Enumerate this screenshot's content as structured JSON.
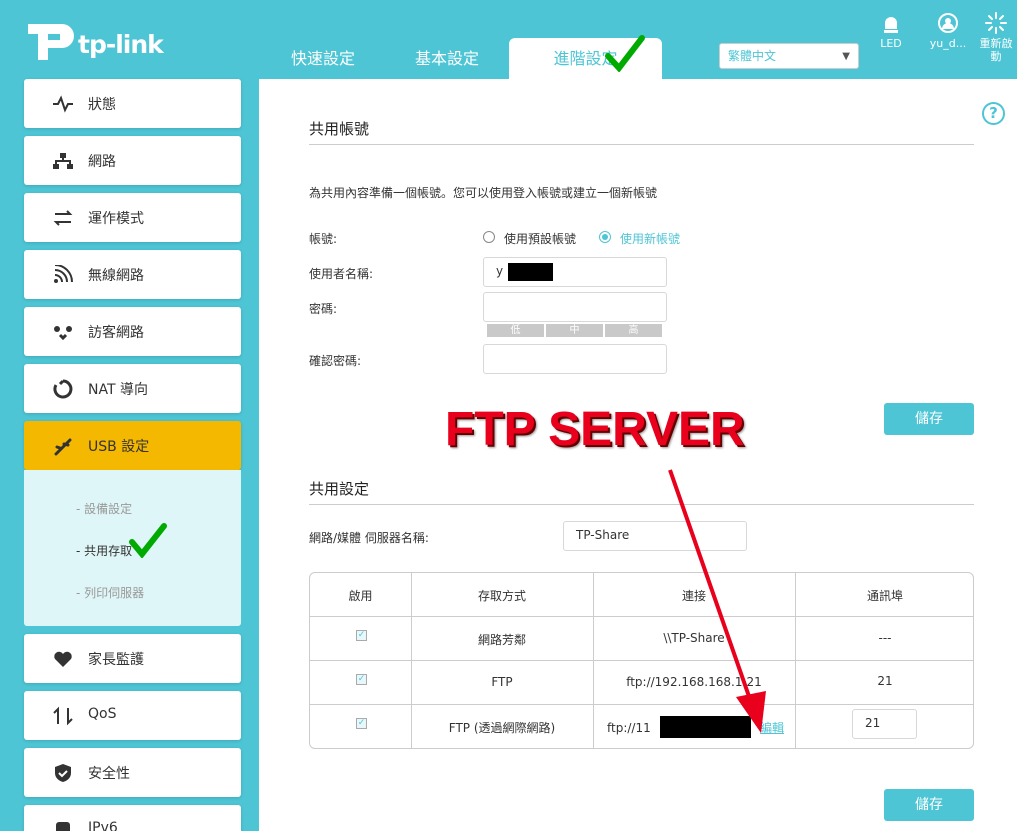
{
  "header": {
    "logo_text": "tp-link",
    "tabs": [
      "快速設定",
      "基本設定",
      "進階設定"
    ],
    "language": "繁體中文",
    "icons": [
      {
        "name": "led-icon",
        "label": "LED"
      },
      {
        "name": "user-icon",
        "label": "yu_d..."
      },
      {
        "name": "reboot-icon",
        "label": "重新啟\n動"
      }
    ]
  },
  "sidebar": {
    "items": [
      {
        "label": "狀態",
        "icon": "status-icon"
      },
      {
        "label": "網路",
        "icon": "network-icon"
      },
      {
        "label": "運作模式",
        "icon": "operation-mode-icon"
      },
      {
        "label": "無線網路",
        "icon": "wireless-icon"
      },
      {
        "label": "訪客網路",
        "icon": "guest-network-icon"
      },
      {
        "label": "NAT 導向",
        "icon": "nat-icon"
      },
      {
        "label": "USB 設定",
        "icon": "usb-icon"
      },
      {
        "label": "家長監護",
        "icon": "parental-control-icon"
      },
      {
        "label": "QoS",
        "icon": "qos-icon"
      },
      {
        "label": "安全性",
        "icon": "security-icon"
      },
      {
        "label": "IPv6",
        "icon": "ipv6-icon"
      }
    ],
    "usb_sub": [
      "設備設定",
      "共用存取",
      "列印伺服器"
    ]
  },
  "account": {
    "title": "共用帳號",
    "desc": "為共用內容準備一個帳號。您可以使用登入帳號或建立一個新帳號",
    "account_label": "帳號:",
    "option_default": "使用預設帳號",
    "option_new": "使用新帳號",
    "username_label": "使用者名稱:",
    "username_value": "y",
    "password_label": "密碼:",
    "strength": [
      "低",
      "中",
      "高"
    ],
    "confirm_label": "確認密碼:",
    "save": "儲存"
  },
  "annotation": "FTP SERVER",
  "sharing": {
    "title": "共用設定",
    "server_name_label": "網路/媒體 伺服器名稱:",
    "server_name_value": "TP-Share",
    "columns": [
      "啟用",
      "存取方式",
      "連接",
      "通訊埠"
    ],
    "rows": [
      {
        "method": "網路芳鄰",
        "link": "\\\\TP-Share",
        "port": "---"
      },
      {
        "method": "FTP",
        "link": "ftp://192.168.168.1:21",
        "port": "21"
      },
      {
        "method": "FTP (透過網際網路)",
        "link": "ftp://11",
        "edit": "編輯",
        "port": "21"
      }
    ],
    "save": "儲存"
  },
  "colors": {
    "accent": "#4dc5d5",
    "active_nav": "#f5b800",
    "annotation": "#e8001c"
  }
}
